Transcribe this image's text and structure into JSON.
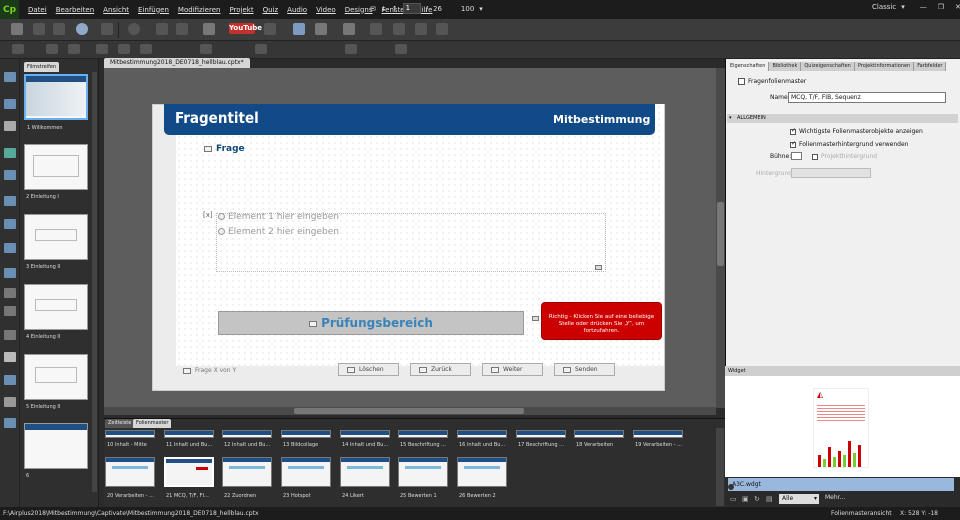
{
  "menubar": {
    "logo": "Cp",
    "items": [
      "Datei",
      "Bearbeiten",
      "Ansicht",
      "Einfügen",
      "Modifizieren",
      "Projekt",
      "Quiz",
      "Audio",
      "Video",
      "Designs",
      "Fenster",
      "Hilfe"
    ],
    "page_current": "1",
    "page_total": "26",
    "zoom": "100",
    "workspace": "Classic"
  },
  "toolbar": {
    "youtube_label": "YouTube"
  },
  "filmstrip": {
    "tab": "Filmstreifen",
    "slides": [
      "1 Willkommen",
      "2 Einleitung I",
      "3 Einleitung II",
      "4 Einleitung II",
      "5 Einleitung II",
      "6"
    ]
  },
  "document": {
    "tab": "Mitbestimmung2018_DE0718_hellblau.cptx*"
  },
  "slide": {
    "title": "Fragentitel",
    "subtitle": "Mitbestimmung",
    "question": "Frage",
    "answer1": "Element 1 hier eingeben",
    "answer2": "Element 2 hier eingeben",
    "review_area": "Prüfungsbereich",
    "correct_message": "Richtig - Klicken Sie auf eine beliebige Stelle oder drücken Sie „Y“, um fortzufahren.",
    "progress": "Frage X von Y",
    "buttons": [
      "Löschen",
      "Zurück",
      "Weiter",
      "Senden"
    ]
  },
  "bottompanel": {
    "tabs": [
      "Zeitleiste",
      "Folienmaster"
    ],
    "masters_row1": [
      "10 Inhalt - Mitte",
      "11 Inhalt und Bu...",
      "12 Inhalt und Bu...",
      "13 Bildcollage",
      "14 Inhalt und Bu...",
      "15 Beschriftung ...",
      "16 Inhalt und Bu...",
      "17 Beschriftung ...",
      "18 Verarbeiten",
      "19 Verarbeiten - ..."
    ],
    "masters_row2": [
      "20 Verarbeiten - ...",
      "21 MCQ, T/F, FI...",
      "22 Zuordnen",
      "23 Hotspot",
      "24 Likert",
      "25 Bewerten 1",
      "26 Bewerten 2"
    ]
  },
  "properties": {
    "tabs": [
      "Eigenschaften",
      "Bibliothek",
      "Quizeigenschaften",
      "Projektinformationen",
      "Farbfelder"
    ],
    "title": "Fragenfolienmaster",
    "name_label": "Name:",
    "name_value": "MCQ, T/F, FIB, Sequenz",
    "section": "ALLGEMEIN",
    "opt1": "Wichtigste Folienmasterobjekte anzeigen",
    "opt2": "Folienmasterhintergrund verwenden",
    "stage_label": "Bühne:",
    "project_bg": "Projekthintergrund",
    "background_label": "Hintergrund:"
  },
  "widget": {
    "header": "Widget",
    "item": "A3C.wdgt",
    "filter": "Alle",
    "more": "Mehr..."
  },
  "status": {
    "path": "F:\\Airplus2018\\Mitbestimmung\\Captivate\\Mitbestimmung2018_DE0718_hellblau.cptx",
    "view": "Folienmasteransicht",
    "coords": "X: 528 Y: -18"
  },
  "colors": {
    "header_blue": "#114a86",
    "correct_red": "#cc0000",
    "accent_green": "#7ed321"
  }
}
